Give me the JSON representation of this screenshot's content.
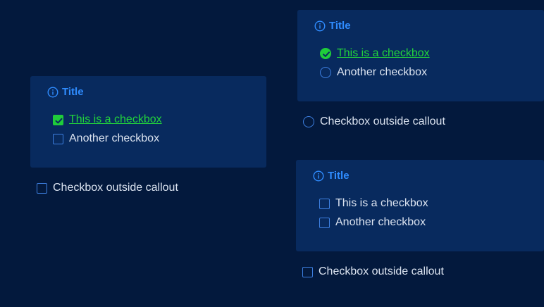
{
  "callout_a": {
    "title": "Title",
    "items": [
      {
        "label": "This is a checkbox",
        "checked": true
      },
      {
        "label": "Another checkbox",
        "checked": false
      }
    ],
    "outside_label": "Checkbox outside callout"
  },
  "callout_b": {
    "title": "Title",
    "items": [
      {
        "label": "This is a checkbox",
        "checked": true
      },
      {
        "label": "Another checkbox",
        "checked": false
      }
    ],
    "outside_label": "Checkbox outside callout"
  },
  "callout_c": {
    "title": "Title",
    "items": [
      {
        "label": "This is a checkbox",
        "checked": false
      },
      {
        "label": "Another checkbox",
        "checked": false
      }
    ],
    "outside_label": "Checkbox outside callout"
  },
  "colors": {
    "background": "#03193d",
    "callout_bg": "#082a5e",
    "accent": "#2f8cff",
    "checked": "#1fcc3a",
    "text": "#dbe3f0"
  },
  "icons": {
    "title": "info-icon",
    "checked": "check-circle-icon"
  }
}
